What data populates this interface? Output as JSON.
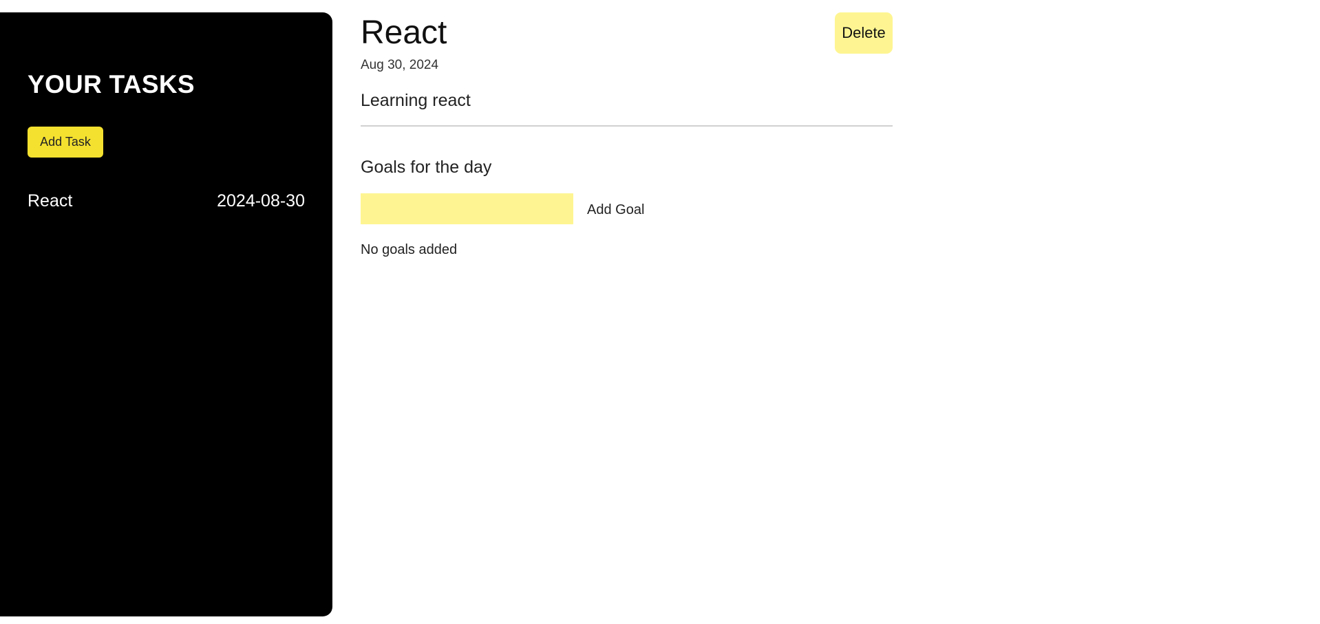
{
  "sidebar": {
    "title": "YOUR TASKS",
    "add_task_label": "Add Task",
    "tasks": [
      {
        "name": "React",
        "date": "2024-08-30"
      }
    ]
  },
  "task": {
    "title": "React",
    "date": "Aug 30, 2024",
    "description": "Learning react",
    "delete_label": "Delete"
  },
  "goals": {
    "heading": "Goals for the day",
    "input_value": "",
    "add_goal_label": "Add Goal",
    "empty_text": "No goals added"
  },
  "colors": {
    "sidebar_bg": "#000000",
    "accent_yellow": "#f4e12f",
    "soft_yellow": "#fef592"
  }
}
